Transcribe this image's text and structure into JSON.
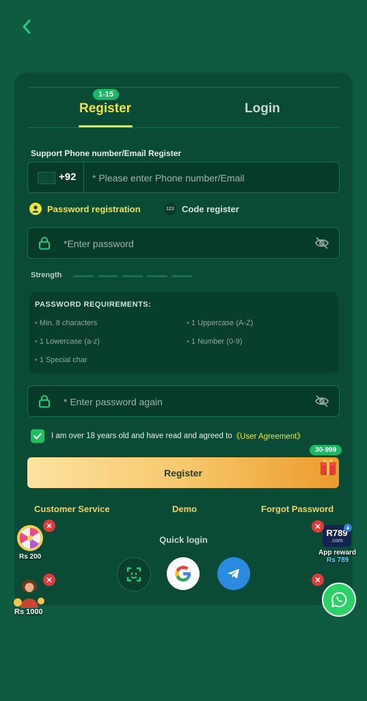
{
  "tabs": {
    "register": "Register",
    "login": "Login",
    "badge": "1-15"
  },
  "form": {
    "support_label": "Support Phone number/Email Register",
    "country_code": "+92",
    "phone_placeholder": "* Please enter Phone number/Email",
    "password_option": "Password registration",
    "code_option": "Code register",
    "code_icon_text": "123",
    "password_placeholder": "*Enter password",
    "strength_label": "Strength",
    "requirements_title": "PASSWORD REQUIREMENTS:",
    "requirements": [
      "Min. 8 characters",
      "1 Uppercase (A-Z)",
      "1 Lowercase (a-z)",
      "1 Number (0-9)",
      "1 Special char"
    ],
    "password_again_placeholder": "* Enter password again",
    "terms_text": "I am over 18 years old and have read and agreed to",
    "terms_link": "《User Agreement》",
    "terms_checked": true,
    "register_button": "Register",
    "promo_badge": "30-999"
  },
  "links": {
    "customer_service": "Customer Service",
    "demo": "Demo",
    "forgot_password": "Forgot Password"
  },
  "quick_login": {
    "label": "Quick login",
    "methods": [
      "scan-icon",
      "google-icon",
      "telegram-icon"
    ]
  },
  "floating": {
    "wheel_amount": "Rs 200",
    "girl_amount": "Rs 1000",
    "app_reward_label": "App reward",
    "app_reward_amount": "Rs 789",
    "app_logo": "R789",
    "app_logo_sub": ".com"
  },
  "colors": {
    "background": "#0e5b41",
    "card": "#0a4b35",
    "accent_yellow": "#f4e23c",
    "badge_green": "#1ab866",
    "close_red": "#e23b3b"
  }
}
